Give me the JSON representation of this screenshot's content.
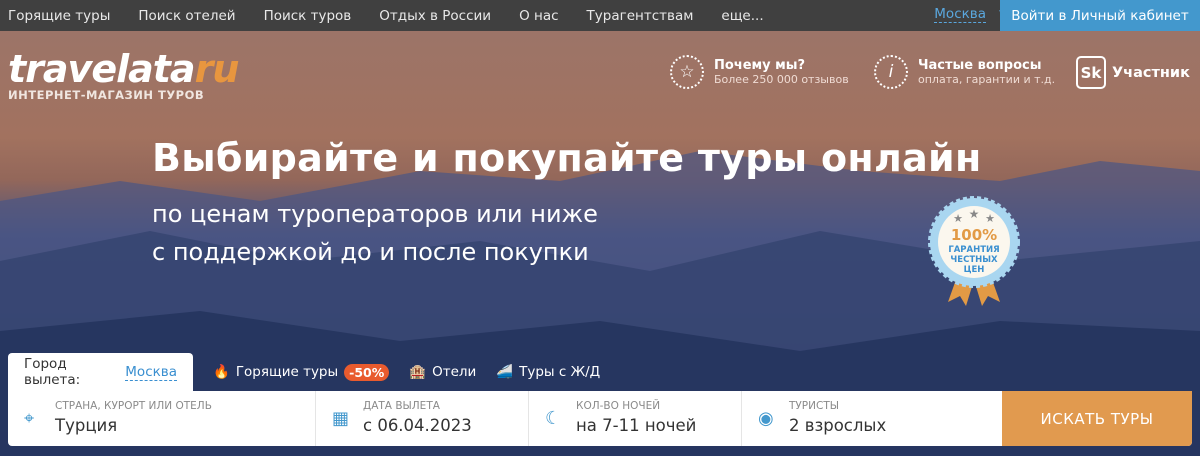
{
  "topnav": {
    "items": [
      "Горящие туры",
      "Поиск отелей",
      "Поиск туров",
      "Отдых в России",
      "О нас",
      "Турагентствам",
      "еще..."
    ],
    "city": "Москва",
    "login": "Войти в Личный кабинет"
  },
  "logo": {
    "main": "travelata",
    "tld": "ru",
    "tagline": "ИНТЕРНЕТ-МАГАЗИН ТУРОВ"
  },
  "info": [
    {
      "title": "Почему мы?",
      "sub": "Более 250 000 отзывов"
    },
    {
      "title": "Частые вопросы",
      "sub": "оплата, гарантии и т.д."
    }
  ],
  "sk": {
    "mark": "Sk",
    "label": "Участник"
  },
  "hero": {
    "title": "Выбирайте и покупайте туры онлайн",
    "line1": "по ценам туроператоров или ниже",
    "line2": "с поддержкой до и после покупки"
  },
  "badge": {
    "pct": "100%",
    "l1": "ГАРАНТИЯ",
    "l2": "ЧЕСТНЫХ",
    "l3": "ЦЕН"
  },
  "tabs": {
    "city_label": "Город вылета:",
    "city": "Москва",
    "hot": "Горящие туры",
    "hot_badge": "-50%",
    "hotels": "Отели",
    "rail": "Туры с Ж/Д"
  },
  "search": {
    "fields": [
      {
        "label": "СТРАНА, КУРОРТ ИЛИ ОТЕЛЬ",
        "value": "Турция"
      },
      {
        "label": "ДАТА ВЫЛЕТА",
        "value": "с 06.04.2023"
      },
      {
        "label": "КОЛ-ВО НОЧЕЙ",
        "value": "на 7-11 ночей"
      },
      {
        "label": "ТУРИСТЫ",
        "value": "2 взрослых"
      }
    ],
    "button": "ИСКАТЬ ТУРЫ"
  }
}
